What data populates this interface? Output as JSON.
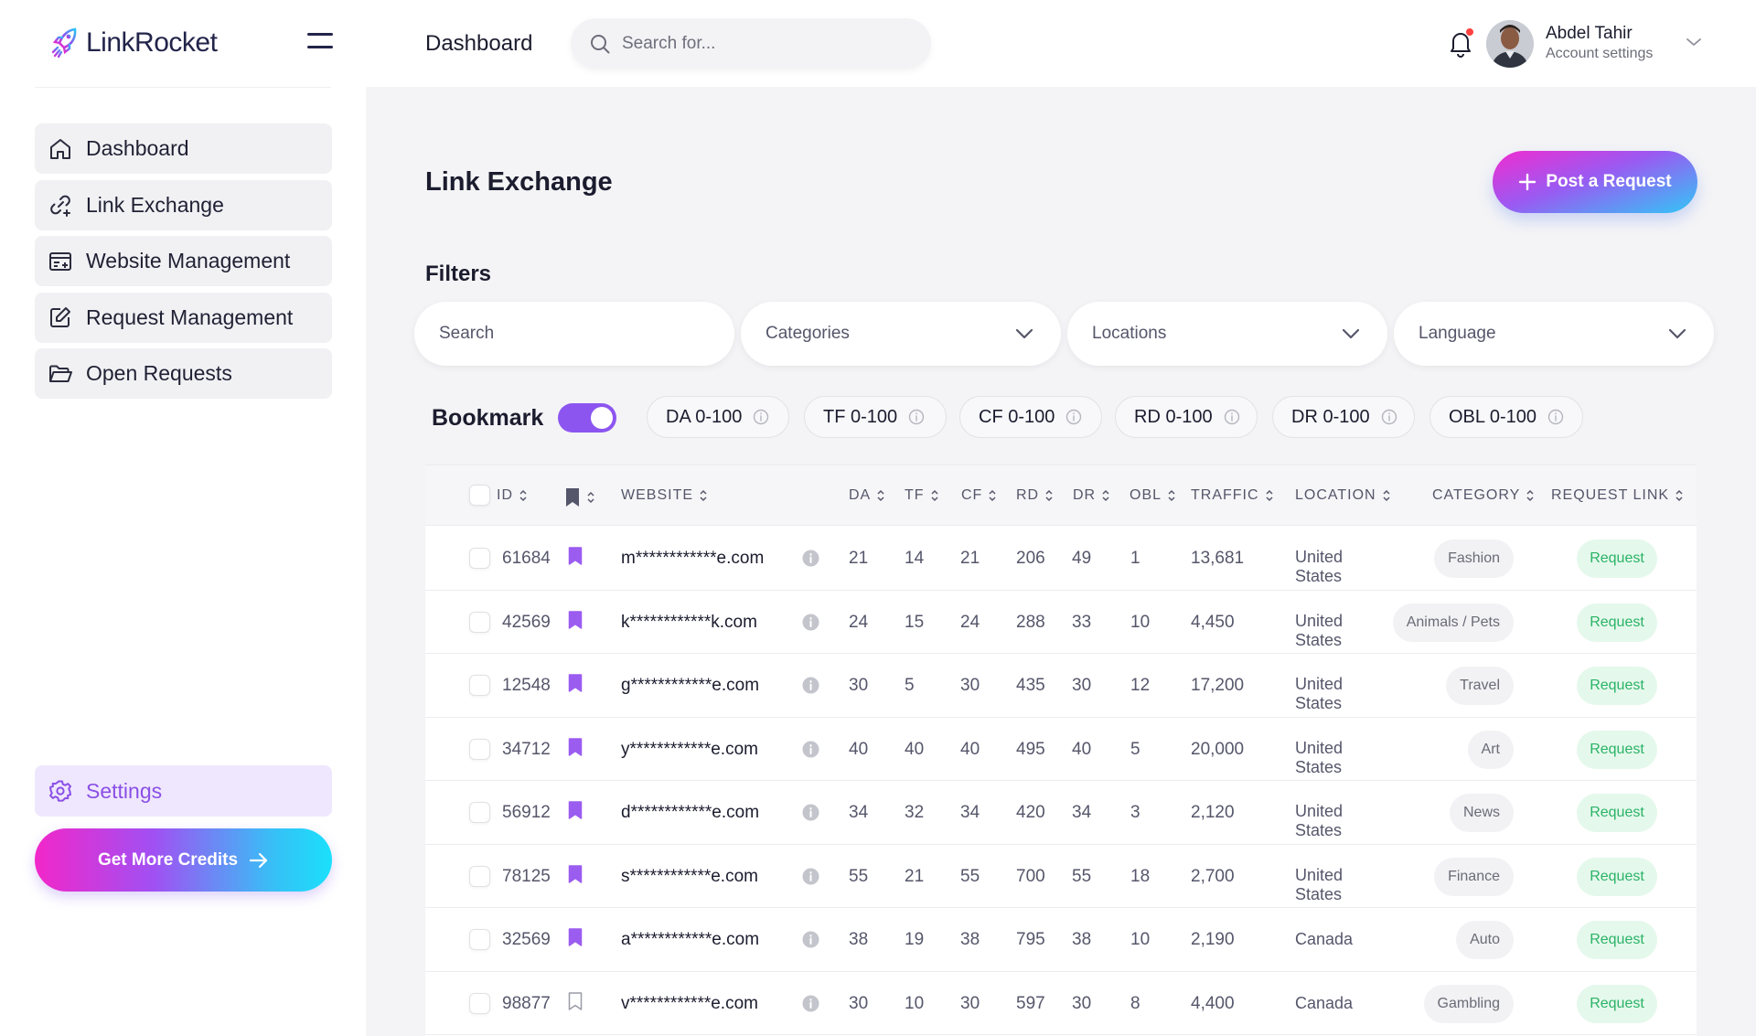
{
  "app": {
    "name": "LinkRocket"
  },
  "sidebar": {
    "items": [
      {
        "label": "Dashboard",
        "icon": "home-icon"
      },
      {
        "label": "Link Exchange",
        "icon": "link-icon"
      },
      {
        "label": "Website Management",
        "icon": "browser-icon"
      },
      {
        "label": "Request Management",
        "icon": "edit-icon"
      },
      {
        "label": "Open Requests",
        "icon": "folder-icon"
      }
    ],
    "settings_label": "Settings",
    "credits_label": "Get More Credits"
  },
  "header": {
    "title": "Dashboard",
    "search_placeholder": "Search for...",
    "user_name": "Abdel Tahir",
    "user_sub": "Account settings"
  },
  "main": {
    "title": "Link Exchange",
    "post_label": "Post a Request",
    "filters_title": "Filters",
    "filter_search_placeholder": "Search",
    "filter_categories": "Categories",
    "filter_locations": "Locations",
    "filter_language": "Language",
    "bookmark_label": "Bookmark",
    "bookmark_on": true,
    "chips": [
      "DA 0-100",
      "TF 0-100",
      "CF 0-100",
      "RD 0-100",
      "DR 0-100",
      "OBL 0-100"
    ]
  },
  "table": {
    "columns": [
      "ID",
      "WEBSITE",
      "DA",
      "TF",
      "CF",
      "RD",
      "DR",
      "OBL",
      "TRAFFIC",
      "LOCATION",
      "CATEGORY",
      "REQUEST LINK"
    ],
    "request_label": "Request",
    "rows": [
      {
        "id": "61684",
        "bookmarked": true,
        "website": "m************e.com",
        "da": "21",
        "tf": "14",
        "cf": "21",
        "rd": "206",
        "dr": "49",
        "obl": "1",
        "traffic": "13,681",
        "loc1": "United",
        "loc2": "States",
        "category": "Fashion"
      },
      {
        "id": "42569",
        "bookmarked": true,
        "website": "k************k.com",
        "da": "24",
        "tf": "15",
        "cf": "24",
        "rd": "288",
        "dr": "33",
        "obl": "10",
        "traffic": "4,450",
        "loc1": "United",
        "loc2": "States",
        "category": "Animals / Pets"
      },
      {
        "id": "12548",
        "bookmarked": true,
        "website": "g************e.com",
        "da": "30",
        "tf": "5",
        "cf": "30",
        "rd": "435",
        "dr": "30",
        "obl": "12",
        "traffic": "17,200",
        "loc1": "United",
        "loc2": "States",
        "category": "Travel"
      },
      {
        "id": "34712",
        "bookmarked": true,
        "website": "y************e.com",
        "da": "40",
        "tf": "40",
        "cf": "40",
        "rd": "495",
        "dr": "40",
        "obl": "5",
        "traffic": "20,000",
        "loc1": "United",
        "loc2": "States",
        "category": "Art"
      },
      {
        "id": "56912",
        "bookmarked": true,
        "website": "d************e.com",
        "da": "34",
        "tf": "32",
        "cf": "34",
        "rd": "420",
        "dr": "34",
        "obl": "3",
        "traffic": "2,120",
        "loc1": "United",
        "loc2": "States",
        "category": "News"
      },
      {
        "id": "78125",
        "bookmarked": true,
        "website": "s************e.com",
        "da": "55",
        "tf": "21",
        "cf": "55",
        "rd": "700",
        "dr": "55",
        "obl": "18",
        "traffic": "2,700",
        "loc1": "United",
        "loc2": "States",
        "category": "Finance"
      },
      {
        "id": "32569",
        "bookmarked": true,
        "website": "a************e.com",
        "da": "38",
        "tf": "19",
        "cf": "38",
        "rd": "795",
        "dr": "38",
        "obl": "10",
        "traffic": "2,190",
        "loc1": "Canada",
        "loc2": "",
        "category": "Auto"
      },
      {
        "id": "98877",
        "bookmarked": false,
        "website": "v************e.com",
        "da": "30",
        "tf": "10",
        "cf": "30",
        "rd": "597",
        "dr": "30",
        "obl": "8",
        "traffic": "4,400",
        "loc1": "Canada",
        "loc2": "",
        "category": "Gambling"
      }
    ]
  },
  "colors": {
    "accent": "#8c55f0",
    "success": "#2ab366",
    "alert": "#ff4141"
  }
}
